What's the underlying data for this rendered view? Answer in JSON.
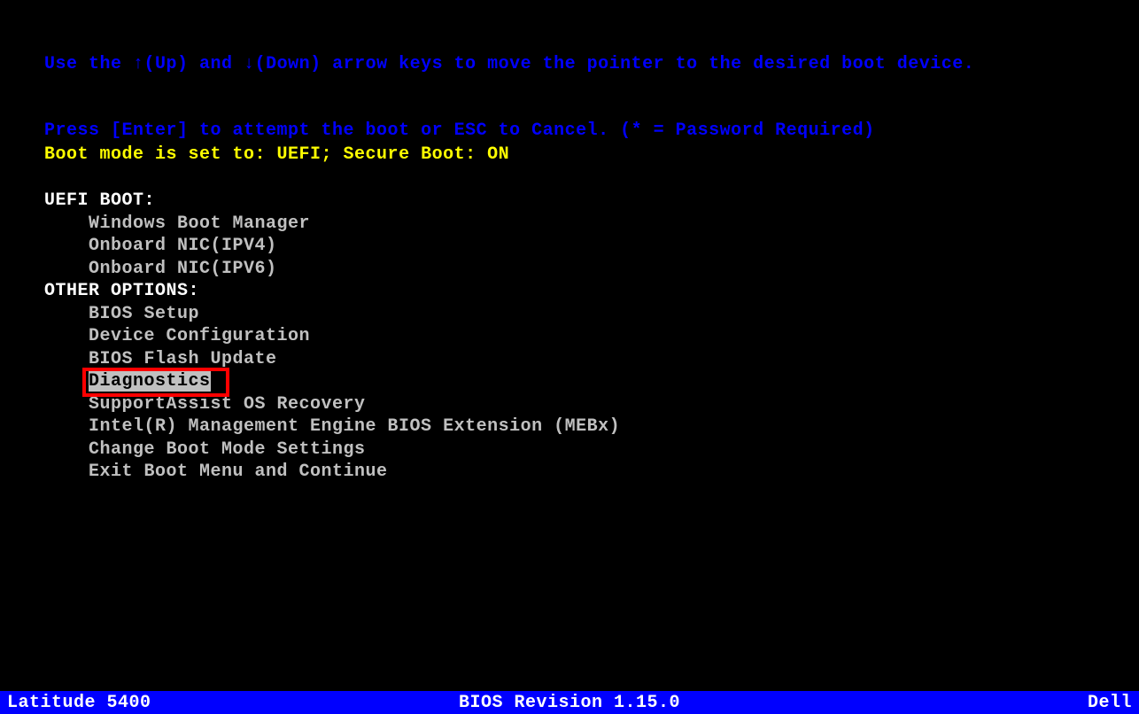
{
  "instructions": {
    "line1_a": "Use the ",
    "line1_up": "↑",
    "line1_b": "(Up) and ",
    "line1_down": "↓",
    "line1_c": "(Down) arrow keys to move the pointer to the desired boot device.",
    "line2": "Press [Enter] to attempt the boot or ESC to Cancel. (* = Password Required)"
  },
  "boot_mode": "Boot mode is set to: UEFI; Secure Boot: ON",
  "sections": {
    "uefi_boot_header": "UEFI BOOT:",
    "uefi_items": [
      "Windows Boot Manager",
      "Onboard NIC(IPV4)",
      "Onboard NIC(IPV6)"
    ],
    "other_header": "OTHER OPTIONS:",
    "other_items": [
      "BIOS Setup",
      "Device Configuration",
      "BIOS Flash Update",
      "Diagnostics",
      "SupportAssist OS Recovery",
      "Intel(R) Management Engine BIOS Extension (MEBx)",
      "Change Boot Mode Settings",
      "Exit Boot Menu and Continue"
    ],
    "selected_index": 3
  },
  "footer": {
    "model": "Latitude 5400",
    "bios": "BIOS Revision 1.15.0",
    "vendor": "Dell"
  }
}
